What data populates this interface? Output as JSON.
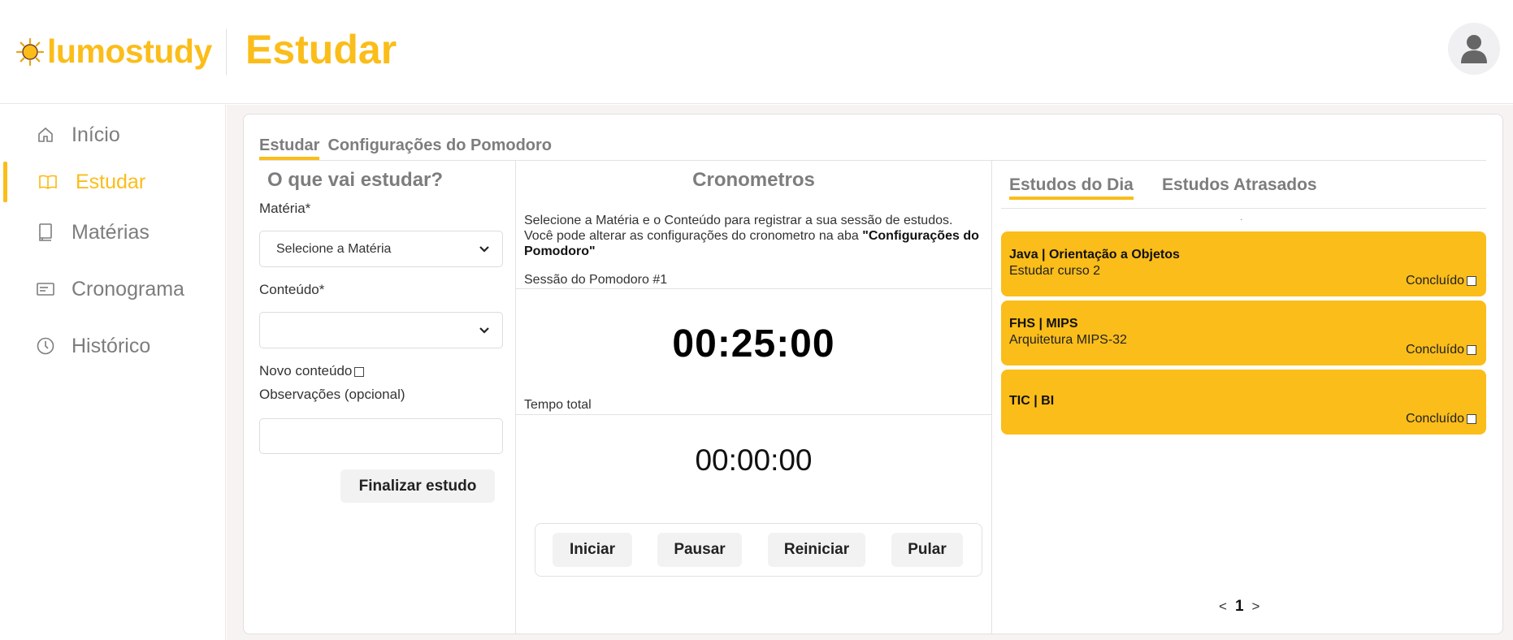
{
  "app": {
    "name": "lumostudy",
    "page_title": "Estudar"
  },
  "colors": {
    "accent": "#fbbd1a",
    "muted": "#7d7d7d"
  },
  "sidebar": {
    "items": [
      {
        "label": "Início",
        "icon": "home-icon"
      },
      {
        "label": "Estudar",
        "icon": "book-open-icon",
        "active": true
      },
      {
        "label": "Matérias",
        "icon": "book-icon"
      },
      {
        "label": "Cronograma",
        "icon": "schedule-icon"
      },
      {
        "label": "Histórico",
        "icon": "clock-icon"
      }
    ]
  },
  "tabs": {
    "study": "Estudar",
    "pomodoro_settings": "Configurações do Pomodoro"
  },
  "form": {
    "title": "O que vai estudar?",
    "subject_label": "Matéria*",
    "subject_value": "Selecione a Matéria",
    "content_label": "Conteúdo*",
    "content_value": "",
    "new_content_label": "Novo conteúdo",
    "notes_label": "Observações (opcional)",
    "notes_value": "",
    "finish_button": "Finalizar estudo"
  },
  "timers": {
    "title": "Cronometros",
    "description": "Selecione a Matéria e o Conteúdo para registrar a sua sessão de estudos. Você pode alterar as configurações do cronometro na aba ",
    "description_bold": "\"Configurações do Pomodoro\"",
    "session_label": "Sessão do Pomodoro #1",
    "session_time": "00:25:00",
    "total_label": "Tempo total",
    "total_time": "00:00:00",
    "buttons": {
      "start": "Iniciar",
      "pause": "Pausar",
      "restart": "Reiniciar",
      "skip": "Pular"
    }
  },
  "daily": {
    "tab_today": "Estudos do Dia",
    "tab_late": "Estudos Atrasados",
    "dot": ".",
    "tasks": [
      {
        "title": "Java | Orientação a Objetos",
        "subtitle": "Estudar curso 2",
        "done_label": "Concluído"
      },
      {
        "title": "FHS | MIPS",
        "subtitle": "Arquitetura MIPS-32",
        "done_label": "Concluído"
      },
      {
        "title": "TIC | BI",
        "subtitle": "",
        "done_label": "Concluído"
      }
    ],
    "pager": {
      "prev": "<",
      "current": "1",
      "next": ">"
    }
  }
}
